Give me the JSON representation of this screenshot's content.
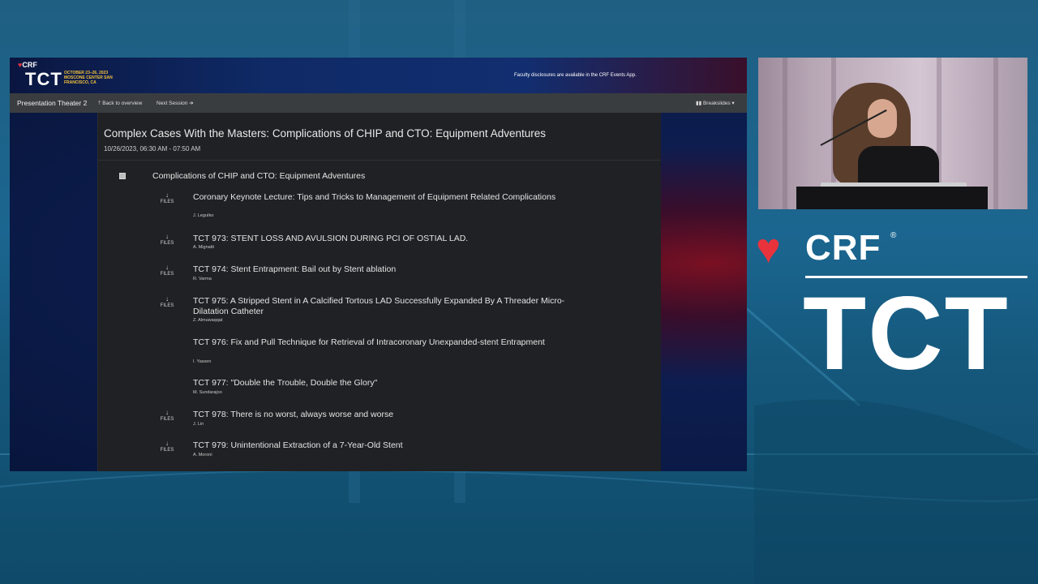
{
  "banner": {
    "brand_small": "CRF",
    "event_small": "TCT",
    "conference_info": "OCTOBER 23–26, 2023 MOSCONE CENTER SAN FRANCISCO, CA",
    "disclosure": "Faculty disclosures are available in the CRF Events App."
  },
  "nav": {
    "room": "Presentation Theater 2",
    "back": "Back to overview",
    "next": "Next Session",
    "breakslides": "Breakslides"
  },
  "session": {
    "title": "Complex Cases With the Masters: Complications of CHIP and CTO: Equipment Adventures",
    "time": "10/26/2023, 06:30 AM - 07:50 AM",
    "group_title": "Complications of CHIP and CTO: Equipment Adventures",
    "files_label": "FILES",
    "items": [
      {
        "title": "Coronary Keynote Lecture: Tips and Tricks to Management of Equipment Related Complications",
        "author": "J. Legutko",
        "has_files": true
      },
      {
        "title": "TCT 973: STENT LOSS AND AVULSION DURING PCI OF OSTIAL LAD.",
        "author": "A. Mignatti",
        "has_files": true
      },
      {
        "title": "TCT 974: Stent Entrapment: Bail out by Stent ablation",
        "author": "R. Varma",
        "has_files": true
      },
      {
        "title": "TCT 975: A Stripped Stent in A Calcified Tortous LAD Successfully Expanded By A Threader Micro-Dilatation Catheter",
        "author": "Z. Almuwaqqat",
        "has_files": true
      },
      {
        "title": "TCT 976: Fix and Pull Technique for Retrieval of Intracoronary Unexpanded-stent Entrapment",
        "author": "I. Yassen",
        "has_files": false
      },
      {
        "title": "TCT 977: \"Double the Trouble, Double the Glory\"",
        "author": "M. Sundarajoo",
        "has_files": false
      },
      {
        "title": "TCT 978: There is no worst, always worse and worse",
        "author": "J. Lin",
        "has_files": true
      },
      {
        "title": "TCT 979: Unintentional Extraction of a 7-Year-Old Stent",
        "author": "A. Moroni",
        "has_files": true
      }
    ]
  },
  "logo": {
    "crf": "CRF",
    "registered": "®",
    "tct": "TCT"
  },
  "colors": {
    "crf_red": "#e8333d",
    "panel_bg": "#202124",
    "navbar_bg": "#3a3d40",
    "conference_gold": "#f4c23c"
  }
}
